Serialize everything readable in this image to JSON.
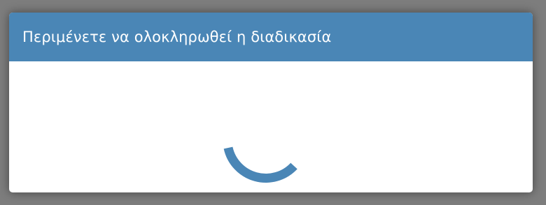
{
  "dialog": {
    "title": "Περιμένετε να ολοκληρωθεί η διαδικασία"
  },
  "spinner": {
    "icon": "loading-spinner-icon",
    "color": "#4a86b6"
  },
  "colors": {
    "header_bg": "#4a86b6",
    "overlay_bg": "#7d7d7d",
    "body_bg": "#ffffff"
  }
}
